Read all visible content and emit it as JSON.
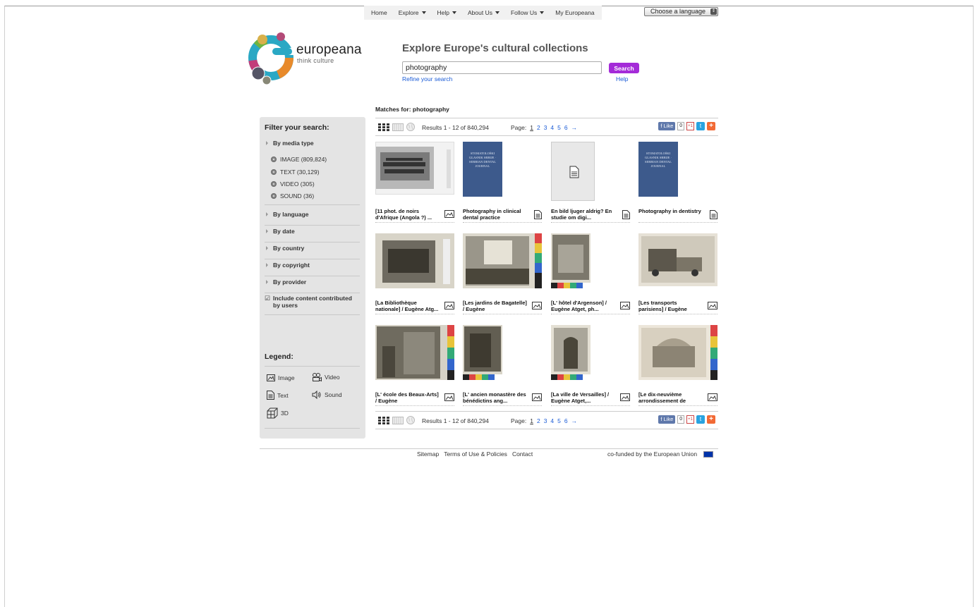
{
  "nav": {
    "items": [
      {
        "label": "Home",
        "dropdown": false
      },
      {
        "label": "Explore",
        "dropdown": true
      },
      {
        "label": "Help",
        "dropdown": true
      },
      {
        "label": "About Us",
        "dropdown": true
      },
      {
        "label": "Follow Us",
        "dropdown": true
      },
      {
        "label": "My Europeana",
        "dropdown": false
      }
    ],
    "language_select": "Choose a language"
  },
  "logo": {
    "word": "europeana",
    "tagline": "think culture"
  },
  "search": {
    "headline": "Explore Europe's cultural collections",
    "query": "photography",
    "button": "Search",
    "refine": "Refine your search",
    "help": "Help"
  },
  "sidebar": {
    "title": "Filter your search:",
    "by_media_type": "By media type",
    "media_types": [
      "IMAGE (809,824)",
      "TEXT (30,129)",
      "VIDEO (305)",
      "SOUND (36)"
    ],
    "filters": [
      "By language",
      "By date",
      "By country",
      "By copyright",
      "By provider"
    ],
    "include_user": "Include content contributed by users",
    "include_checked": true,
    "legend_title": "Legend:",
    "legend": {
      "image": "Image",
      "video": "Video",
      "text": "Text",
      "sound": "Sound",
      "threed": "3D"
    }
  },
  "results": {
    "matches_label": "Matches for:",
    "matches_query": "photography",
    "summary": "Results 1 - 12 of 840,294",
    "page_label": "Page:",
    "pages": [
      "1",
      "2",
      "3",
      "4",
      "5",
      "6"
    ],
    "current_page": "1",
    "next_arrow": "→",
    "like": "Like",
    "like_count": "0",
    "gplus": "+1",
    "items": [
      {
        "title": "[11 phot. de noirs d'Afrique (Angola ?) ...",
        "type": "image"
      },
      {
        "title": "Photography in clinical dental practice",
        "type": "text"
      },
      {
        "title": "En bild ljuger aldrig? En studie om digi...",
        "type": "text"
      },
      {
        "title": "Photography in dentistry",
        "type": "text"
      },
      {
        "title": "[La Bibliothèque nationale] / Eugène Atg...",
        "type": "image"
      },
      {
        "title": "[Les jardins de Bagatelle] / Eugène",
        "type": "image"
      },
      {
        "title": "[L' hôtel d'Argenson] / Eugène Atget, ph...",
        "type": "image"
      },
      {
        "title": "[Les transports parisiens] / Eugène",
        "type": "image"
      },
      {
        "title": "[L' école des Beaux-Arts] / Eugène",
        "type": "image"
      },
      {
        "title": "[L' ancien monastère des bénédictins ang...",
        "type": "image"
      },
      {
        "title": "[La ville de Versailles] / Eugène Atget,...",
        "type": "image"
      },
      {
        "title": "[Le dix-neuvième arrondissement de",
        "type": "image"
      }
    ],
    "journal_cover_text": "STOMATOLOŠKI GLASNIK SRBIJE · SERBIAN DENTAL JOURNAL"
  },
  "footer": {
    "links": [
      "Sitemap",
      "Terms of Use & Policies",
      "Contact"
    ],
    "eu": "co-funded by the European Union"
  },
  "colors": {
    "accent": "#a42bd8",
    "link": "#1a5bd6",
    "sidebar": "#e4e4e4",
    "journal": "#3d5a8c"
  }
}
